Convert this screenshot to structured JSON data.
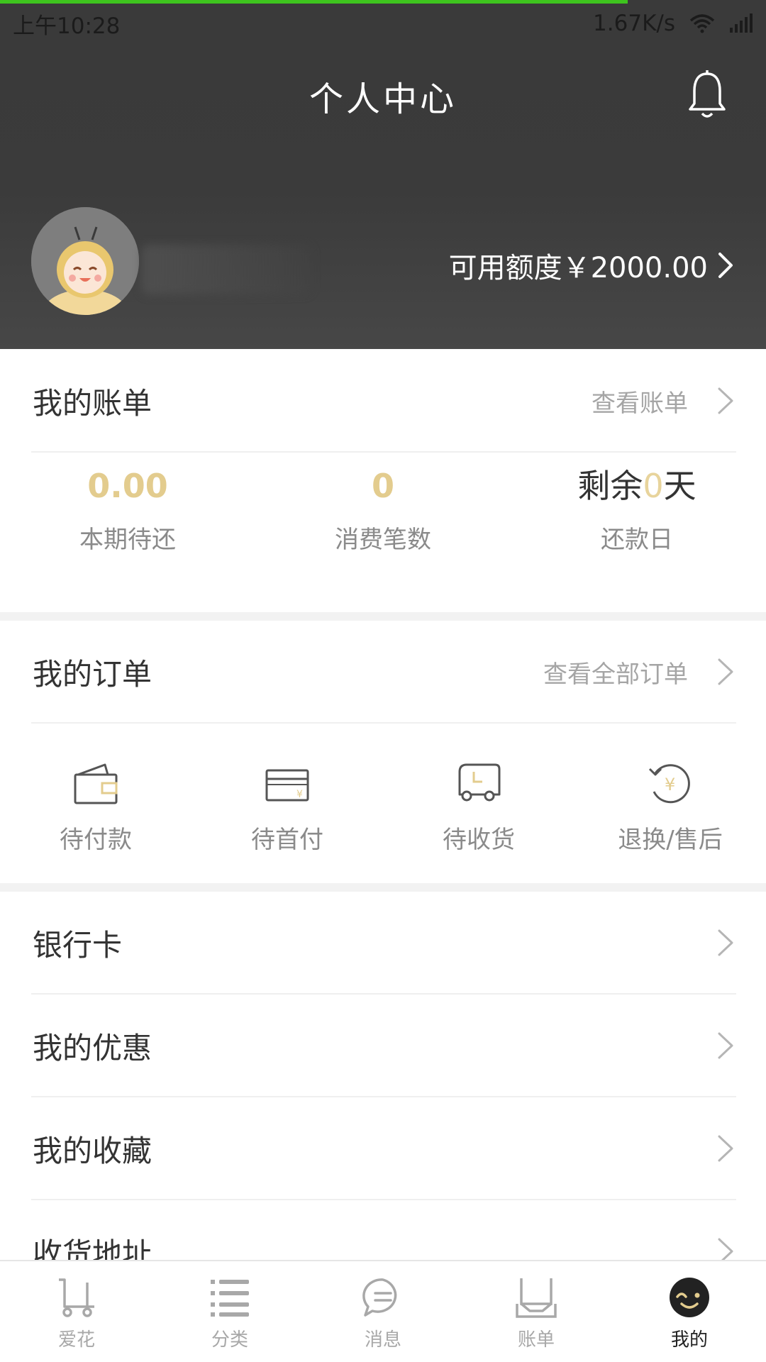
{
  "status_bar": {
    "time": "上午10:28",
    "network_speed": "1.67K/s"
  },
  "header": {
    "title": "个人中心",
    "credit_text": "可用额度￥2000.00"
  },
  "bill": {
    "title": "我的账单",
    "link": "查看账单",
    "stats": [
      {
        "value": "0.00",
        "label": "本期待还"
      },
      {
        "value": "0",
        "label": "消费笔数"
      },
      {
        "prefix": "剩余",
        "value": "0",
        "suffix": "天",
        "label": "还款日"
      }
    ]
  },
  "orders": {
    "title": "我的订单",
    "link": "查看全部订单",
    "items": [
      {
        "label": "待付款",
        "icon": "wallet-icon"
      },
      {
        "label": "待首付",
        "icon": "card-icon"
      },
      {
        "label": "待收货",
        "icon": "truck-icon"
      },
      {
        "label": "退换/售后",
        "icon": "refund-icon"
      }
    ]
  },
  "menu": [
    {
      "label": "银行卡"
    },
    {
      "label": "我的优惠"
    },
    {
      "label": "我的收藏"
    },
    {
      "label": "收货地址"
    }
  ],
  "tabbar": [
    {
      "label": "爱花",
      "icon": "cart-icon"
    },
    {
      "label": "分类",
      "icon": "list-icon"
    },
    {
      "label": "消息",
      "icon": "chat-icon"
    },
    {
      "label": "账单",
      "icon": "inbox-icon"
    },
    {
      "label": "我的",
      "icon": "smile-face-icon",
      "active": true
    }
  ],
  "colors": {
    "header_bg": "#3b3b3b",
    "accent_gold": "#e3cc8e",
    "progress_green": "#3ec41e"
  }
}
